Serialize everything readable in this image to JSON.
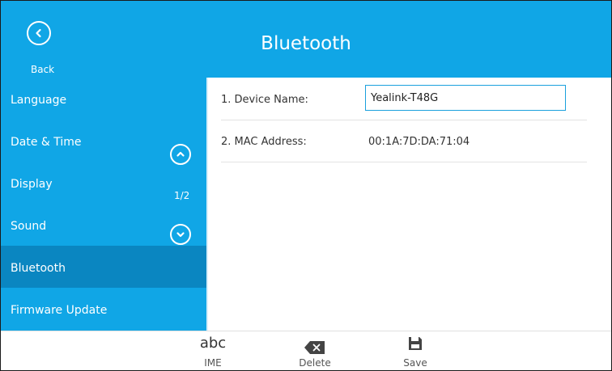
{
  "header": {
    "title": "Bluetooth",
    "back_label": "Back"
  },
  "sidebar": {
    "items": [
      {
        "label": "Language",
        "selected": false
      },
      {
        "label": "Date & Time",
        "selected": false
      },
      {
        "label": "Display",
        "selected": false
      },
      {
        "label": "Sound",
        "selected": false
      },
      {
        "label": "Bluetooth",
        "selected": true
      },
      {
        "label": "Firmware Update",
        "selected": false
      }
    ],
    "page_indicator": "1/2"
  },
  "settings": {
    "rows": [
      {
        "label": "1. Device Name:",
        "value": "Yealink-T48G",
        "editable": true
      },
      {
        "label": "2. MAC Address:",
        "value": "00:1A:7D:DA:71:04",
        "editable": false
      }
    ]
  },
  "toolbar": {
    "ime_icon_text": "abc",
    "ime_label": "IME",
    "delete_label": "Delete",
    "save_label": "Save"
  },
  "colors": {
    "accent": "#10a6e6",
    "selected": "#0a86c1",
    "input_border": "#1aa0dd"
  }
}
